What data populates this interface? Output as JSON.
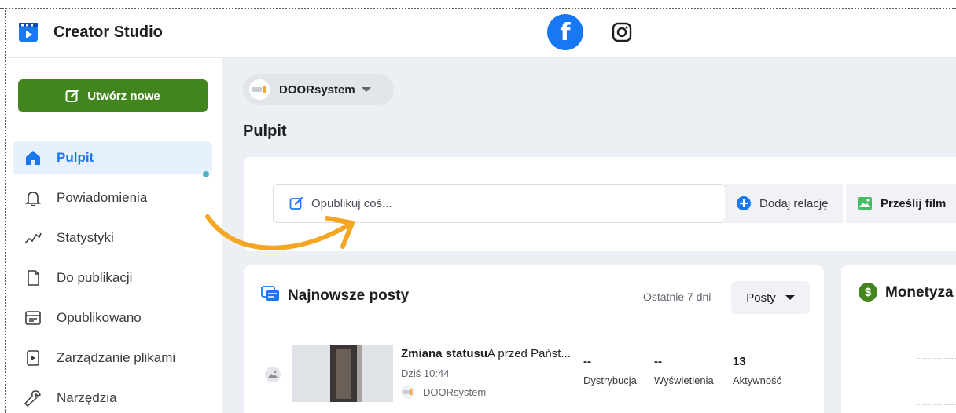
{
  "header": {
    "app_title": "Creator Studio",
    "icons": {
      "logo": "creator-studio-logo",
      "facebook": "facebook-icon",
      "instagram": "instagram-icon"
    },
    "facebook_glyph": "f"
  },
  "sidebar": {
    "create_label": "Utwórz nowe",
    "items": [
      {
        "label": "Pulpit",
        "icon": "home-icon",
        "active": true
      },
      {
        "label": "Powiadomienia",
        "icon": "bell-icon",
        "active": false
      },
      {
        "label": "Statystyki",
        "icon": "stats-icon",
        "active": false
      },
      {
        "label": "Do publikacji",
        "icon": "document-icon",
        "active": false
      },
      {
        "label": "Opublikowano",
        "icon": "published-icon",
        "active": false
      },
      {
        "label": "Zarządzanie plikami",
        "icon": "media-icon",
        "active": false
      },
      {
        "label": "Narzędzia",
        "icon": "wrench-icon",
        "active": false
      }
    ]
  },
  "main": {
    "page_selector": {
      "name": "DOORsystem"
    },
    "section_title": "Pulpit",
    "compose": {
      "placeholder": "Opublikuj coś...",
      "add_relation": "Dodaj relację",
      "upload_film": "Prześlij film"
    },
    "recent_posts": {
      "title": "Najnowsze posty",
      "range": "Ostatnie 7 dni",
      "filter": "Posty",
      "post": {
        "title_bold": "Zmiana statusu",
        "title_rest": "A przed Państ...",
        "time": "Dziś 10:44",
        "page": "DOORsystem",
        "stats": [
          {
            "value": "--",
            "label": "Dystrybucja"
          },
          {
            "value": "--",
            "label": "Wyświetlenia"
          },
          {
            "value": "13",
            "label": "Aktywność"
          }
        ]
      }
    },
    "monetization": {
      "title": "Monetyza",
      "icon_glyph": "$"
    }
  },
  "colors": {
    "facebook_blue": "#1877f2",
    "create_green": "#42851f",
    "active_bg": "#e7f0fd",
    "arrow_orange": "#f5a623",
    "main_bg": "#eceff3"
  }
}
